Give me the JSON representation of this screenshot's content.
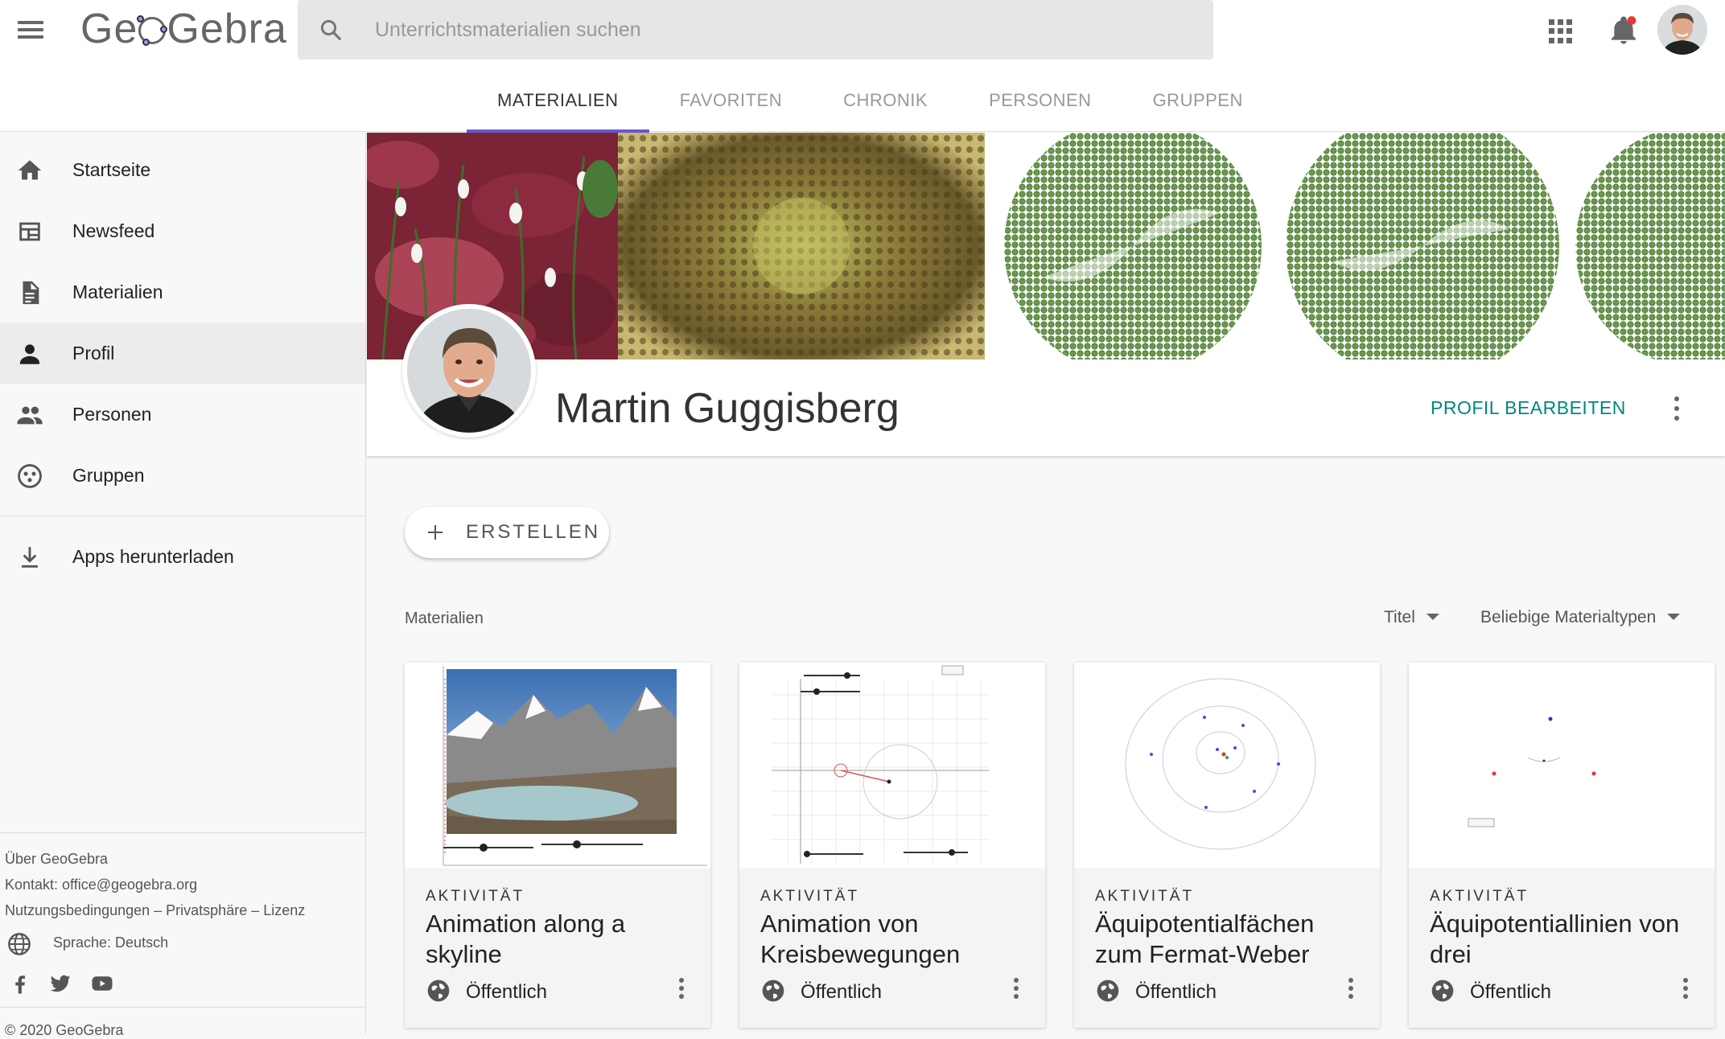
{
  "header": {
    "logo": "GeoGebra",
    "search_placeholder": "Unterrichtsmaterialien suchen",
    "tabs": [
      {
        "label": "MATERIALIEN",
        "active": true
      },
      {
        "label": "FAVORITEN"
      },
      {
        "label": "CHRONIK"
      },
      {
        "label": "PERSONEN"
      },
      {
        "label": "GRUPPEN"
      }
    ]
  },
  "sidebar": {
    "items": [
      {
        "label": "Startseite",
        "icon": "home-icon"
      },
      {
        "label": "Newsfeed",
        "icon": "newsfeed-icon"
      },
      {
        "label": "Materialien",
        "icon": "document-icon"
      },
      {
        "label": "Profil",
        "icon": "person-icon",
        "active": true
      },
      {
        "label": "Personen",
        "icon": "people-icon"
      },
      {
        "label": "Gruppen",
        "icon": "groups-icon"
      }
    ],
    "download": "Apps herunterladen",
    "footer": {
      "about": "Über GeoGebra",
      "contact": "Kontakt: office@geogebra.org",
      "legal": "Nutzungsbedingungen – Privatsphäre – Lizenz",
      "language": "Sprache: Deutsch",
      "copyright": "© 2020 GeoGebra"
    }
  },
  "profile": {
    "name": "Martin Guggisberg",
    "edit_label": "PROFIL BEARBEITEN"
  },
  "main": {
    "create_label": "ERSTELLEN",
    "section_title": "Materialien",
    "sort_label": "Titel",
    "type_filter": "Beliebige Materialtypen",
    "cards": [
      {
        "type": "AKTIVITÄT",
        "title": "Animation along a skyline",
        "visibility": "Öffentlich"
      },
      {
        "type": "AKTIVITÄT",
        "title": "Animation von Kreisbewegungen",
        "visibility": "Öffentlich"
      },
      {
        "type": "AKTIVITÄT",
        "title": "Äquipotentialfächen zum Fermat-Weber",
        "visibility": "Öffentlich"
      },
      {
        "type": "AKTIVITÄT",
        "title": "Äquipotentiallinien von drei",
        "visibility": "Öffentlich"
      }
    ]
  },
  "colors": {
    "accent": "#6557d2",
    "edit": "#00897b",
    "notification": "#e53935",
    "spiral": "#6a9a4a"
  }
}
